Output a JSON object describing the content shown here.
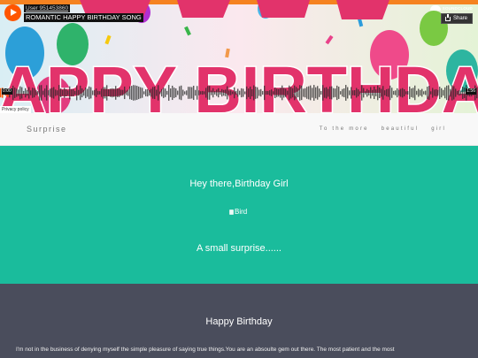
{
  "player": {
    "user": "User 951453860",
    "title": "ROMANTIC HAPPY BIRTHDAY SONG",
    "artwork_text": "HAPPY BIRTHDAY",
    "logo": "SOUNDCLOUD",
    "share_label": "Share",
    "time_elapsed": "0:00",
    "time_total": "1:56",
    "privacy": "Privacy policy",
    "accent_color": "#ff5500"
  },
  "navbar": {
    "brand": "Surprise",
    "links": [
      "To the more",
      "beautiful",
      "girl"
    ]
  },
  "hero": {
    "heading": "Hey there,Birthday Girl",
    "image_alt": "Bird",
    "subheading": "A small surprise......",
    "bg_color": "#1abc9c"
  },
  "section": {
    "heading": "Happy Birthday",
    "text": "I'm not in the business of denying myself the simple pleasure of saying true things.You are an absoulte gem out there. The most patient and the most",
    "bg_color": "#4a4d5c"
  }
}
